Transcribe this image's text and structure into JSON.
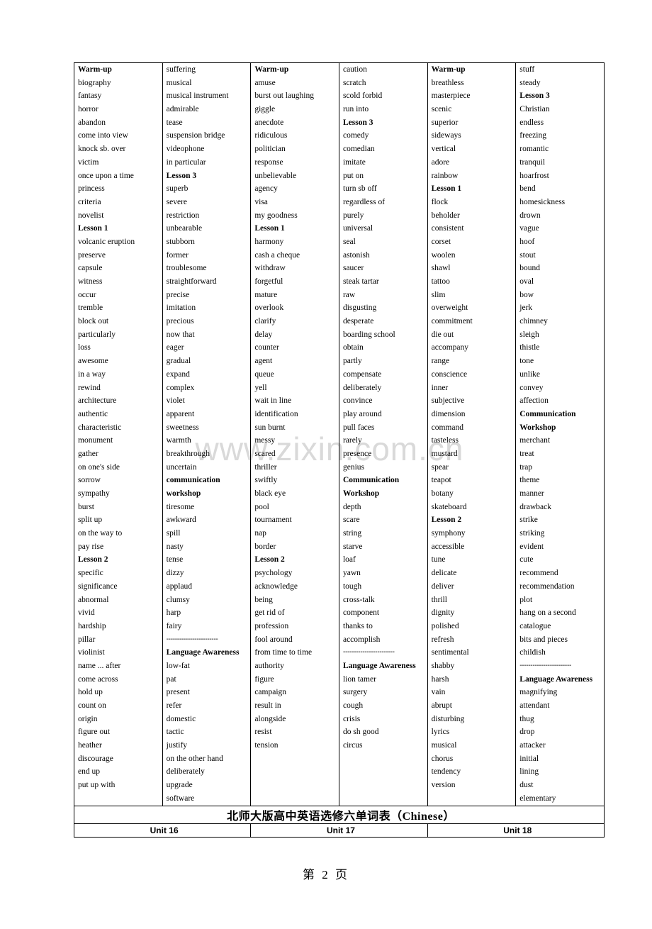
{
  "document": {
    "title_cn": "北师大版高中英语选修六单词表（Chinese）",
    "page_footer": "第 2 页"
  },
  "units": [
    {
      "label": "Unit 16"
    },
    {
      "label": "Unit 17"
    },
    {
      "label": "Unit 18"
    }
  ],
  "watermark": "www.zixin.com.cn",
  "columns": [
    {
      "id": "unit16-col1",
      "words": [
        {
          "t": "Warm-up",
          "b": true
        },
        {
          "t": "biography"
        },
        {
          "t": "fantasy"
        },
        {
          "t": "horror"
        },
        {
          "t": "abandon"
        },
        {
          "t": "come into view"
        },
        {
          "t": "knock sb. over"
        },
        {
          "t": "victim"
        },
        {
          "t": "once upon a time"
        },
        {
          "t": "princess"
        },
        {
          "t": "criteria"
        },
        {
          "t": "novelist"
        },
        {
          "t": "Lesson 1",
          "b": true
        },
        {
          "t": "volcanic eruption"
        },
        {
          "t": "preserve"
        },
        {
          "t": "capsule"
        },
        {
          "t": "witness"
        },
        {
          "t": "occur"
        },
        {
          "t": "tremble"
        },
        {
          "t": "block out"
        },
        {
          "t": "particularly"
        },
        {
          "t": "loss"
        },
        {
          "t": "awesome"
        },
        {
          "t": "in a way"
        },
        {
          "t": "rewind"
        },
        {
          "t": "architecture"
        },
        {
          "t": "authentic"
        },
        {
          "t": "characteristic"
        },
        {
          "t": "monument"
        },
        {
          "t": "gather"
        },
        {
          "t": "on one's side"
        },
        {
          "t": "sorrow"
        },
        {
          "t": "sympathy"
        },
        {
          "t": "burst"
        },
        {
          "t": "split up"
        },
        {
          "t": "on the way to"
        },
        {
          "t": "pay rise"
        },
        {
          "t": "Lesson 2",
          "b": true
        },
        {
          "t": "specific"
        },
        {
          "t": "significance"
        },
        {
          "t": "abnormal"
        },
        {
          "t": "vivid"
        },
        {
          "t": "hardship"
        },
        {
          "t": "pillar"
        },
        {
          "t": "violinist"
        },
        {
          "t": "name ... after"
        },
        {
          "t": "come across"
        },
        {
          "t": "hold up"
        },
        {
          "t": "count on"
        },
        {
          "t": "origin"
        },
        {
          "t": "figure out"
        },
        {
          "t": "heather"
        },
        {
          "t": "discourage"
        },
        {
          "t": "end up"
        },
        {
          "t": "put up with"
        }
      ]
    },
    {
      "id": "unit16-col2",
      "words": [
        {
          "t": "suffering"
        },
        {
          "t": "musical"
        },
        {
          "t": "musical instrument"
        },
        {
          "t": "admirable"
        },
        {
          "t": "tease"
        },
        {
          "t": "suspension bridge"
        },
        {
          "t": "videophone"
        },
        {
          "t": "in particular"
        },
        {
          "t": "Lesson 3",
          "b": true
        },
        {
          "t": "superb"
        },
        {
          "t": "severe"
        },
        {
          "t": "restriction"
        },
        {
          "t": "unbearable"
        },
        {
          "t": "stubborn"
        },
        {
          "t": "former"
        },
        {
          "t": "troublesome"
        },
        {
          "t": "straightforward"
        },
        {
          "t": "precise"
        },
        {
          "t": "imitation"
        },
        {
          "t": "precious"
        },
        {
          "t": "now that"
        },
        {
          "t": "eager"
        },
        {
          "t": "gradual"
        },
        {
          "t": "expand"
        },
        {
          "t": "complex"
        },
        {
          "t": "violet"
        },
        {
          "t": "apparent"
        },
        {
          "t": "sweetness"
        },
        {
          "t": "warmth"
        },
        {
          "t": "breakthrough"
        },
        {
          "t": "uncertain"
        },
        {
          "t": "communication",
          "b": true
        },
        {
          "t": "workshop",
          "b": true
        },
        {
          "t": "tiresome"
        },
        {
          "t": "awkward"
        },
        {
          "t": "spill"
        },
        {
          "t": "nasty"
        },
        {
          "t": "tense"
        },
        {
          "t": "dizzy"
        },
        {
          "t": "applaud"
        },
        {
          "t": "clumsy"
        },
        {
          "t": "harp"
        },
        {
          "t": "fairy"
        },
        {
          "t": "------------------------",
          "d": true
        },
        {
          "t": "Language Awareness",
          "b": true
        },
        {
          "t": "low-fat"
        },
        {
          "t": "pat"
        },
        {
          "t": "present"
        },
        {
          "t": "refer"
        },
        {
          "t": "domestic"
        },
        {
          "t": "tactic"
        },
        {
          "t": "justify"
        },
        {
          "t": "on the other hand"
        },
        {
          "t": "deliberately"
        },
        {
          "t": "upgrade"
        },
        {
          "t": "software"
        }
      ]
    },
    {
      "id": "unit17-col1",
      "words": [
        {
          "t": "Warm-up",
          "b": true
        },
        {
          "t": "amuse"
        },
        {
          "t": "burst out laughing"
        },
        {
          "t": "giggle"
        },
        {
          "t": "anecdote"
        },
        {
          "t": "ridiculous"
        },
        {
          "t": "politician"
        },
        {
          "t": "response"
        },
        {
          "t": "unbelievable"
        },
        {
          "t": "agency"
        },
        {
          "t": "visa"
        },
        {
          "t": "my goodness"
        },
        {
          "t": "Lesson 1",
          "b": true
        },
        {
          "t": "harmony"
        },
        {
          "t": "cash a cheque"
        },
        {
          "t": "withdraw"
        },
        {
          "t": "forgetful"
        },
        {
          "t": "mature"
        },
        {
          "t": "overlook"
        },
        {
          "t": "clarify"
        },
        {
          "t": "delay"
        },
        {
          "t": "counter"
        },
        {
          "t": "agent"
        },
        {
          "t": "queue"
        },
        {
          "t": "yell"
        },
        {
          "t": "wait in line"
        },
        {
          "t": "identification"
        },
        {
          "t": "sun burnt"
        },
        {
          "t": "messy"
        },
        {
          "t": "scared"
        },
        {
          "t": "thriller"
        },
        {
          "t": "swiftly"
        },
        {
          "t": "black eye"
        },
        {
          "t": "pool"
        },
        {
          "t": "tournament"
        },
        {
          "t": "nap"
        },
        {
          "t": "border"
        },
        {
          "t": "Lesson 2",
          "b": true
        },
        {
          "t": "psychology"
        },
        {
          "t": "acknowledge"
        },
        {
          "t": "being"
        },
        {
          "t": "get rid of"
        },
        {
          "t": "profession"
        },
        {
          "t": "fool around"
        },
        {
          "t": "from time to time"
        },
        {
          "t": "authority"
        },
        {
          "t": "figure"
        },
        {
          "t": "campaign"
        },
        {
          "t": "result in"
        },
        {
          "t": "alongside"
        },
        {
          "t": "resist"
        },
        {
          "t": "tension"
        }
      ]
    },
    {
      "id": "unit17-col2",
      "words": [
        {
          "t": "caution"
        },
        {
          "t": "scratch"
        },
        {
          "t": "scold forbid"
        },
        {
          "t": "run into"
        },
        {
          "t": "Lesson 3",
          "b": true
        },
        {
          "t": "comedy"
        },
        {
          "t": "comedian"
        },
        {
          "t": "imitate"
        },
        {
          "t": "put on"
        },
        {
          "t": "turn sb off"
        },
        {
          "t": "regardless of"
        },
        {
          "t": "purely"
        },
        {
          "t": "universal"
        },
        {
          "t": "seal"
        },
        {
          "t": "astonish"
        },
        {
          "t": "saucer"
        },
        {
          "t": "steak tartar"
        },
        {
          "t": "raw"
        },
        {
          "t": "disgusting"
        },
        {
          "t": "desperate"
        },
        {
          "t": "boarding school"
        },
        {
          "t": "obtain"
        },
        {
          "t": "partly"
        },
        {
          "t": "compensate"
        },
        {
          "t": "deliberately"
        },
        {
          "t": "convince"
        },
        {
          "t": "play around"
        },
        {
          "t": "pull faces"
        },
        {
          "t": "rarely"
        },
        {
          "t": "presence"
        },
        {
          "t": "genius"
        },
        {
          "t": "Communication",
          "b": true
        },
        {
          "t": "Workshop",
          "b": true
        },
        {
          "t": "depth"
        },
        {
          "t": "scare"
        },
        {
          "t": "string"
        },
        {
          "t": "starve"
        },
        {
          "t": "loaf"
        },
        {
          "t": "yawn"
        },
        {
          "t": "tough"
        },
        {
          "t": "cross-talk"
        },
        {
          "t": "component"
        },
        {
          "t": "thanks to"
        },
        {
          "t": "accomplish"
        },
        {
          "t": "------------------------",
          "d": true
        },
        {
          "t": "Language Awareness",
          "b": true
        },
        {
          "t": "lion tamer"
        },
        {
          "t": "surgery"
        },
        {
          "t": "cough"
        },
        {
          "t": "crisis"
        },
        {
          "t": "do sh good"
        },
        {
          "t": "circus"
        }
      ]
    },
    {
      "id": "unit18-col1",
      "words": [
        {
          "t": "Warm-up",
          "b": true
        },
        {
          "t": "breathless"
        },
        {
          "t": "masterpiece"
        },
        {
          "t": "scenic"
        },
        {
          "t": "superior"
        },
        {
          "t": "sideways"
        },
        {
          "t": "vertical"
        },
        {
          "t": "adore"
        },
        {
          "t": "rainbow"
        },
        {
          "t": "Lesson 1",
          "b": true
        },
        {
          "t": "flock"
        },
        {
          "t": "beholder"
        },
        {
          "t": "consistent"
        },
        {
          "t": "corset"
        },
        {
          "t": "woolen"
        },
        {
          "t": "shawl"
        },
        {
          "t": "tattoo"
        },
        {
          "t": "slim"
        },
        {
          "t": "overweight"
        },
        {
          "t": "commitment"
        },
        {
          "t": "die out"
        },
        {
          "t": "accompany"
        },
        {
          "t": "range"
        },
        {
          "t": "conscience"
        },
        {
          "t": "inner"
        },
        {
          "t": "subjective"
        },
        {
          "t": "dimension"
        },
        {
          "t": "command"
        },
        {
          "t": "tasteless"
        },
        {
          "t": "mustard"
        },
        {
          "t": "spear"
        },
        {
          "t": "teapot"
        },
        {
          "t": "botany"
        },
        {
          "t": "skateboard"
        },
        {
          "t": "Lesson 2",
          "b": true
        },
        {
          "t": "symphony"
        },
        {
          "t": "accessible"
        },
        {
          "t": "tune"
        },
        {
          "t": "delicate"
        },
        {
          "t": "deliver"
        },
        {
          "t": "thrill"
        },
        {
          "t": "dignity"
        },
        {
          "t": "polished"
        },
        {
          "t": "refresh"
        },
        {
          "t": "sentimental"
        },
        {
          "t": "shabby"
        },
        {
          "t": "harsh"
        },
        {
          "t": "vain"
        },
        {
          "t": "abrupt"
        },
        {
          "t": "disturbing"
        },
        {
          "t": "lyrics"
        },
        {
          "t": "musical"
        },
        {
          "t": "chorus"
        },
        {
          "t": "tendency"
        },
        {
          "t": "version"
        }
      ]
    },
    {
      "id": "unit18-col2",
      "words": [
        {
          "t": "stuff"
        },
        {
          "t": "steady"
        },
        {
          "t": "Lesson 3",
          "b": true
        },
        {
          "t": "Christian"
        },
        {
          "t": "endless"
        },
        {
          "t": "freezing"
        },
        {
          "t": "romantic"
        },
        {
          "t": "tranquil"
        },
        {
          "t": "hoarfrost"
        },
        {
          "t": "bend"
        },
        {
          "t": "homesickness"
        },
        {
          "t": "drown"
        },
        {
          "t": "vague"
        },
        {
          "t": "hoof"
        },
        {
          "t": "stout"
        },
        {
          "t": "bound"
        },
        {
          "t": "oval"
        },
        {
          "t": "bow"
        },
        {
          "t": "jerk"
        },
        {
          "t": "chimney"
        },
        {
          "t": "sleigh"
        },
        {
          "t": "thistle"
        },
        {
          "t": "tone"
        },
        {
          "t": "unlike"
        },
        {
          "t": "convey"
        },
        {
          "t": "affection"
        },
        {
          "t": "Communication",
          "b": true
        },
        {
          "t": "Workshop",
          "b": true
        },
        {
          "t": "merchant"
        },
        {
          "t": "treat"
        },
        {
          "t": "trap"
        },
        {
          "t": "theme"
        },
        {
          "t": "manner"
        },
        {
          "t": "drawback"
        },
        {
          "t": "strike"
        },
        {
          "t": "striking"
        },
        {
          "t": "evident"
        },
        {
          "t": "cute"
        },
        {
          "t": "recommend"
        },
        {
          "t": "recommendation"
        },
        {
          "t": "plot"
        },
        {
          "t": "hang on a second"
        },
        {
          "t": "catalogue"
        },
        {
          "t": "bits and pieces"
        },
        {
          "t": "childish"
        },
        {
          "t": "------------------------",
          "d": true
        },
        {
          "t": "Language Awareness",
          "b": true
        },
        {
          "t": "magnifying"
        },
        {
          "t": "attendant"
        },
        {
          "t": "thug"
        },
        {
          "t": "drop"
        },
        {
          "t": "attacker"
        },
        {
          "t": "initial"
        },
        {
          "t": "lining"
        },
        {
          "t": "dust"
        },
        {
          "t": "elementary"
        }
      ]
    }
  ]
}
